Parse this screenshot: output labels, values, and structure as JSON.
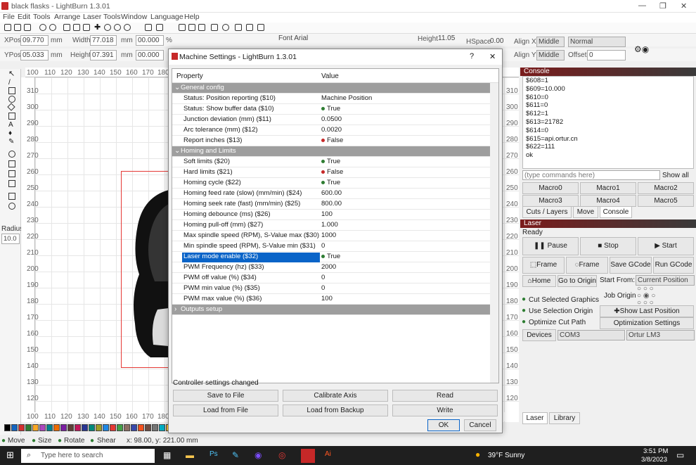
{
  "app": {
    "title": "black flasks - LightBurn 1.3.01",
    "accent": "#c62828"
  },
  "menu": [
    "File",
    "Edit",
    "Tools",
    "Arrange",
    "Laser Tools",
    "Window",
    "Language",
    "Help"
  ],
  "props": {
    "xpos_label": "XPos",
    "xpos": "09.770",
    "width_label": "Width",
    "width": "77.018",
    "mm": "mm",
    "scale1": "00.000",
    "pct": "%",
    "ypos_label": "YPos",
    "ypos": "05.033",
    "height_label": "Height",
    "height": "07.391",
    "scale2": "00.000",
    "font": "Font Arial",
    "fheight_label": "Height",
    "fheight": "11.05",
    "hspace_label": "HSpace",
    "hspace": "0.00",
    "alignx_label": "Align X",
    "alignx": "Middle",
    "normal": "Normal",
    "aligny_label": "Align Y",
    "aligny": "Middle",
    "offset_label": "Offset",
    "offset": "0"
  },
  "rulers": {
    "top": [
      "100",
      "110",
      "120",
      "130",
      "140",
      "150",
      "160",
      "170",
      "180"
    ],
    "left": [
      "310",
      "300",
      "290",
      "280",
      "270",
      "260",
      "250",
      "240",
      "230",
      "220",
      "210",
      "200",
      "190",
      "180",
      "170",
      "160",
      "150",
      "140",
      "130",
      "120"
    ],
    "right": [
      "310",
      "300",
      "290",
      "280",
      "270",
      "260",
      "250",
      "240",
      "230",
      "220",
      "210",
      "200",
      "190",
      "180",
      "170",
      "160",
      "150",
      "140",
      "130",
      "120"
    ],
    "bottom": [
      "100",
      "110",
      "120",
      "130",
      "140",
      "150",
      "160",
      "170",
      "180"
    ]
  },
  "radius": {
    "label": "Radius:",
    "value": "10.0"
  },
  "status": {
    "move": "Move",
    "size": "Size",
    "rotate": "Rotate",
    "shear": "Shear",
    "coords": "x: 98.00, y: 221.00 mm"
  },
  "palette": [
    "#000000",
    "#1565c0",
    "#d32f2f",
    "#2e7d32",
    "#f9a825",
    "#ab47bc",
    "#00838f",
    "#ef6c00",
    "#7b1fa2",
    "#5d4037",
    "#c2185b",
    "#283593",
    "#00897b",
    "#9e9d24",
    "#1e88e5",
    "#e53935",
    "#43a047",
    "#8d6e63",
    "#3949ab",
    "#f4511e",
    "#6d4c41",
    "#757575",
    "#00acc1",
    "#fbc02d"
  ],
  "dialog": {
    "title": "Machine Settings - LightBurn 1.3.01",
    "help": "?",
    "close": "✕",
    "col_property": "Property",
    "col_value": "Value",
    "rows": [
      {
        "type": "section",
        "label": "General config"
      },
      {
        "label": "Status: Position reporting ($10)",
        "value": "Machine Position"
      },
      {
        "label": "Status: Show buffer data ($10)",
        "value": "True",
        "dot": "#2e7d32"
      },
      {
        "label": "Junction deviation (mm) ($11)",
        "value": "0.0500"
      },
      {
        "label": "Arc tolerance (mm) ($12)",
        "value": "0.0020"
      },
      {
        "label": "Report inches ($13)",
        "value": "False",
        "dot": "#c62828"
      },
      {
        "type": "section",
        "label": "Homing and Limits"
      },
      {
        "label": "Soft limits ($20)",
        "value": "True",
        "dot": "#2e7d32"
      },
      {
        "label": "Hard limits ($21)",
        "value": "False",
        "dot": "#c62828"
      },
      {
        "label": "Homing cycle ($22)",
        "value": "True",
        "dot": "#2e7d32"
      },
      {
        "label": "Homing feed rate (slow) (mm/min) ($24)",
        "value": "600.00"
      },
      {
        "label": "Homing seek rate (fast) (mm/min) ($25)",
        "value": "800.00"
      },
      {
        "label": "Homing debounce (ms) ($26)",
        "value": "100"
      },
      {
        "label": "Homing pull-off (mm) ($27)",
        "value": "1.000"
      },
      {
        "label": "Max spindle speed (RPM), S-Value max ($30)",
        "value": "1000"
      },
      {
        "label": "Min spindle speed (RPM), S-Value min ($31)",
        "value": "0"
      },
      {
        "label": "Laser mode enable ($32)",
        "value": "True",
        "dot": "#2e7d32",
        "selected": true
      },
      {
        "label": "PWM Frequency (hz) ($33)",
        "value": "2000"
      },
      {
        "label": "PWM off value (%) ($34)",
        "value": "0"
      },
      {
        "label": "PWM min value (%) ($35)",
        "value": "0"
      },
      {
        "label": "PWM max value (%) ($36)",
        "value": "100"
      },
      {
        "type": "section",
        "label": "Outputs setup",
        "collapsed": true
      }
    ],
    "status": "Controller settings changed",
    "buttons": {
      "save": "Save to File",
      "calibrate": "Calibrate Axis",
      "read": "Read",
      "load": "Load from File",
      "load_backup": "Load from Backup",
      "write": "Write",
      "ok": "OK",
      "cancel": "Cancel"
    }
  },
  "console": {
    "title": "Console",
    "lines": [
      "$608=1",
      "$609=10.000",
      "$610=0",
      "$611=0",
      "$612=1",
      "$613=21782",
      "$614=0",
      "$615=api.ortur.cn",
      "$622=111",
      "ok"
    ],
    "placeholder": "(type commands here)",
    "show_all": "Show all",
    "macros": [
      "Macro0",
      "Macro1",
      "Macro2",
      "Macro3",
      "Macro4",
      "Macro5"
    ],
    "tabs": [
      "Cuts / Layers",
      "Move",
      "Console"
    ]
  },
  "laser": {
    "title": "Laser",
    "state": "Ready",
    "pause": "Pause",
    "stop": "Stop",
    "start": "Start",
    "frame1": "Frame",
    "frame2": "Frame",
    "save_gcode": "Save GCode",
    "run_gcode": "Run GCode",
    "home": "Home",
    "goto_origin": "Go to Origin",
    "start_from_label": "Start From:",
    "start_from": "Current Position",
    "cut_selected": "Cut Selected Graphics",
    "use_selection_origin": "Use Selection Origin",
    "optimize": "Optimize Cut Path",
    "job_origin": "Job Origin",
    "show_last": "Show Last Position",
    "opt_settings": "Optimization Settings",
    "devices": "Devices",
    "port": "COM3",
    "device": "Ortur LM3",
    "tabs": [
      "Laser",
      "Library"
    ]
  },
  "taskbar": {
    "search": "Type here to search",
    "weather": "39°F Sunny",
    "time": "3:51 PM",
    "date": "3/8/2023"
  }
}
